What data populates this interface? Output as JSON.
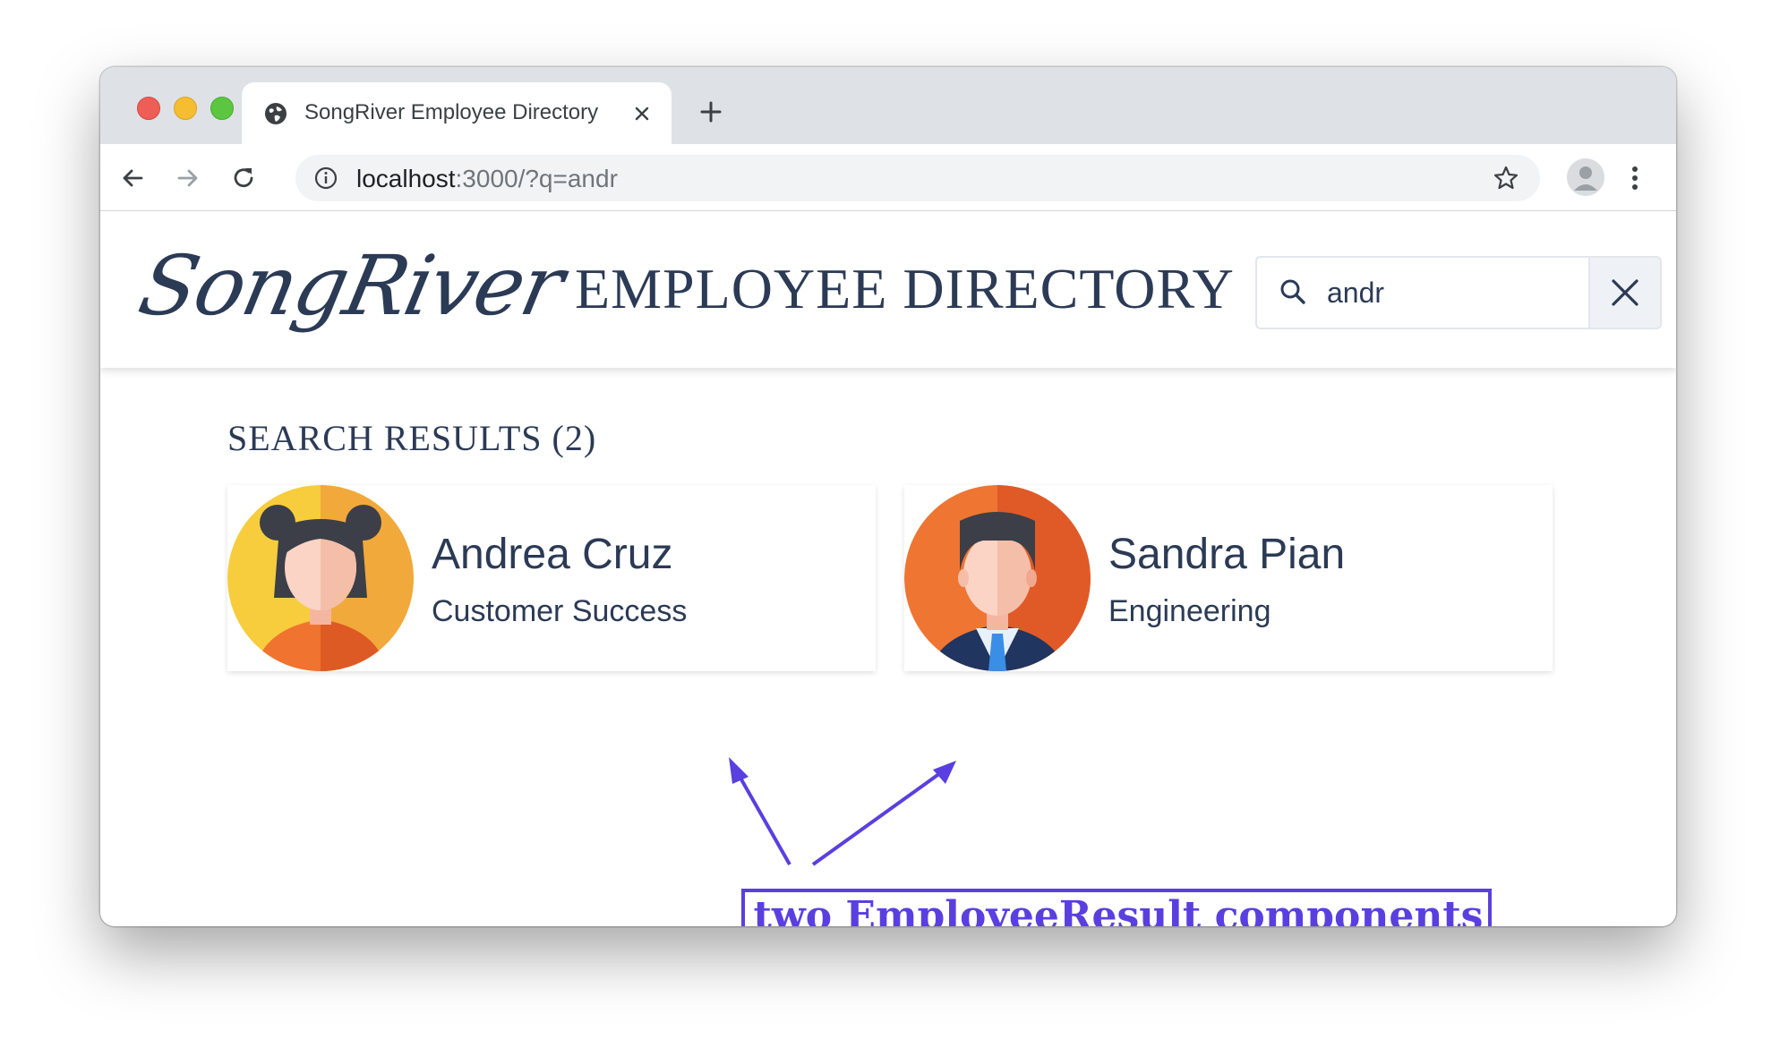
{
  "browser": {
    "tab_title": "SongRiver Employee Directory",
    "url_host": "localhost",
    "url_rest": ":3000/?q=andr"
  },
  "header": {
    "logo_text": "SongRiver",
    "title": "EMPLOYEE DIRECTORY",
    "search_value": "andr"
  },
  "results": {
    "heading": "SEARCH RESULTS (2)",
    "employees": [
      {
        "name": "Andrea Cruz",
        "department": "Customer Success",
        "avatar": "woman-avatar"
      },
      {
        "name": "Sandra Pian",
        "department": "Engineering",
        "avatar": "man-avatar"
      }
    ]
  },
  "annotation": {
    "label": "two EmployeeResult components",
    "color": "#5a3fe0"
  },
  "colors": {
    "brand_text": "#2b3a55",
    "annotation": "#5a3fe0"
  }
}
